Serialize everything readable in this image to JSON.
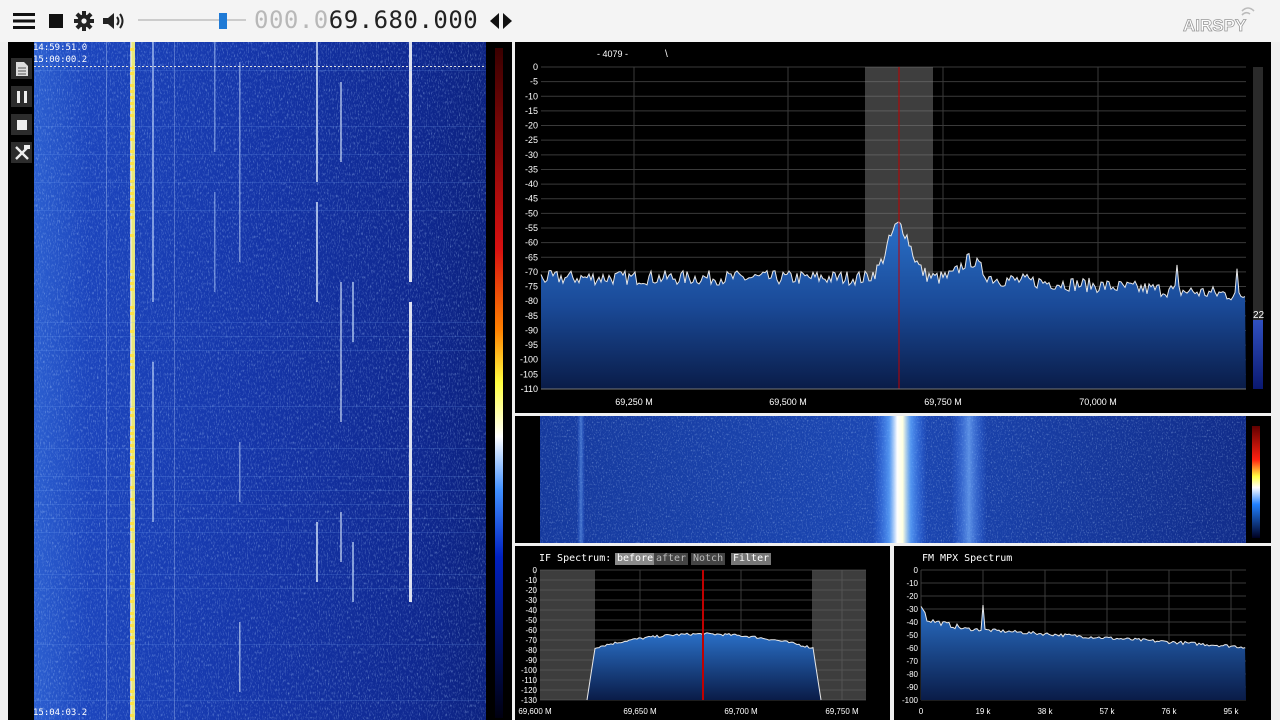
{
  "toolbar": {
    "frequency_dim": "000.0",
    "frequency_bright": "69.680.000",
    "volume_level": 0.78,
    "logo_text": "AIRSPY"
  },
  "waterfall": {
    "timestamps": [
      "14:59:51.0",
      "15:00:00.2",
      "15:04:03.2"
    ]
  },
  "spectrum": {
    "header_value": "- 4079 -",
    "header_mark": "\\",
    "y_ticks": [
      "0",
      "-5",
      "-10",
      "-15",
      "-20",
      "-25",
      "-30",
      "-35",
      "-40",
      "-45",
      "-50",
      "-55",
      "-60",
      "-65",
      "-70",
      "-75",
      "-80",
      "-85",
      "-90",
      "-95",
      "-100",
      "-105",
      "-110"
    ],
    "x_ticks": [
      "69,250 M",
      "69,500 M",
      "69,750 M",
      "70,000 M"
    ],
    "level_value": "22"
  },
  "if_spectrum": {
    "title": "IF Spectrum:",
    "tabs": [
      "before",
      "after",
      "Notch",
      "Filter"
    ],
    "y_ticks": [
      "0",
      "-10",
      "-20",
      "-30",
      "-40",
      "-50",
      "-60",
      "-70",
      "-80",
      "-90",
      "-100",
      "-110",
      "-120",
      "-130"
    ],
    "x_ticks": [
      "69,600 M",
      "69,650 M",
      "69,700 M",
      "69,750 M"
    ]
  },
  "mpx_spectrum": {
    "title": "FM MPX Spectrum",
    "y_ticks": [
      "0",
      "-10",
      "-20",
      "-30",
      "-40",
      "-50",
      "-60",
      "-70",
      "-80",
      "-90",
      "-100"
    ],
    "x_ticks": [
      "0",
      "19 k",
      "38 k",
      "57 k",
      "76 k",
      "95 k"
    ]
  },
  "colors": {
    "accent": "#1f7ad6",
    "spectrum_fill": "#1e5aa8",
    "waterfall_bg": "#0a2a9a",
    "marker": "#c00000"
  }
}
